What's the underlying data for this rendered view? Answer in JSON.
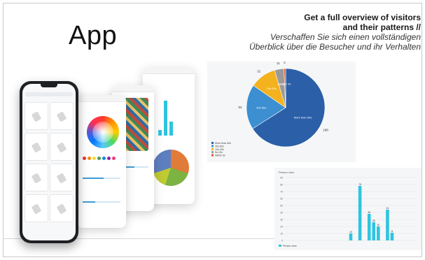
{
  "title": "App",
  "headline": {
    "en_line1": "Get a full overview of visitors",
    "en_line2": "and their patterns //",
    "de_line1": "Verschaffen Sie sich einen vollständigen",
    "de_line2": "Überblick über die Besucher und ihr Verhalten"
  },
  "chart_data": [
    {
      "type": "pie",
      "labels": [
        "More than 60s",
        "30s-60s",
        "10s-30s",
        "5s-10s",
        "Within 5s"
      ],
      "values": [
        188,
        53,
        31,
        11,
        2
      ],
      "slice_labels": [
        "More than 60s",
        "30s-60s",
        "10s-30s",
        "5s-10s",
        "Within 5s"
      ],
      "colors": [
        "#2b5fa8",
        "#3c8fd0",
        "#f3b21e",
        "#9a9a9a",
        "#e8552b"
      ],
      "legend_position": "bottom-left"
    },
    {
      "type": "bar",
      "title": "Person view",
      "legend": [
        "Person view"
      ],
      "color": "#2ec4e0",
      "ylim": [
        0,
        90
      ],
      "values": [
        0,
        0,
        0,
        0,
        0,
        0,
        0,
        0,
        0,
        0,
        0,
        0,
        0,
        0,
        10,
        0,
        78,
        0,
        38,
        26,
        20,
        0,
        44,
        11,
        0,
        0,
        0,
        0,
        0
      ],
      "grid": true,
      "legend_position": "bottom-left"
    }
  ]
}
